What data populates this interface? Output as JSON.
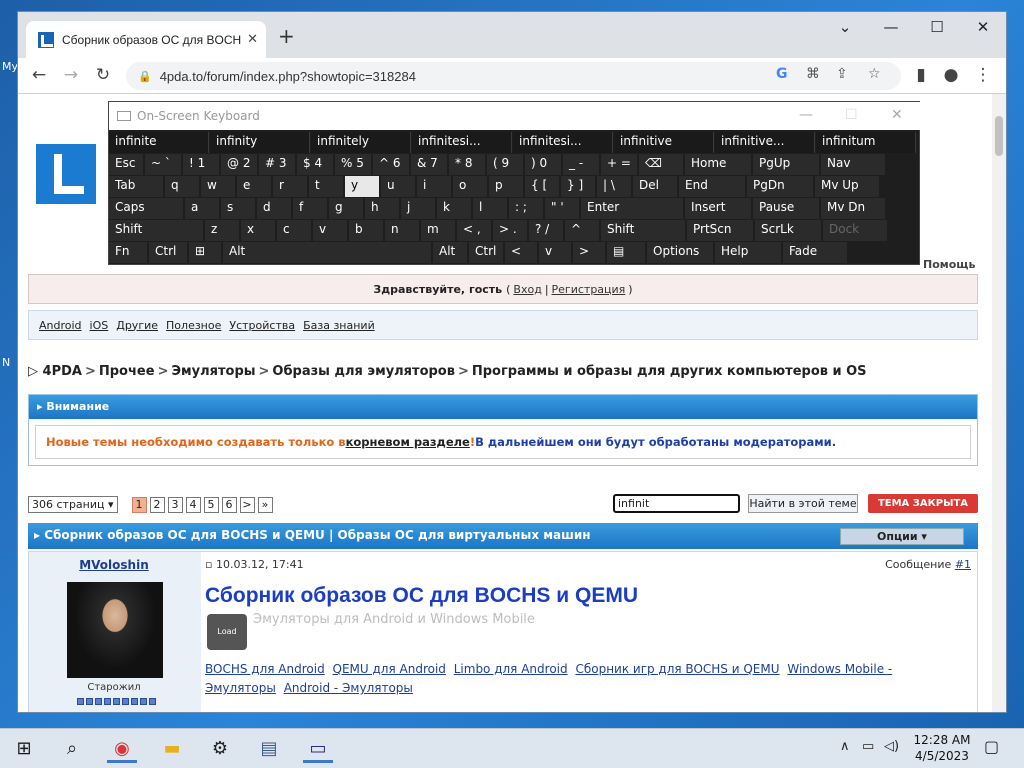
{
  "desktop": {
    "frags": [
      "My",
      "N"
    ]
  },
  "browser": {
    "tab_title": "Сборник образов ОС для BOCHS и QEMU",
    "url": "4pda.to/forum/index.php?showtopic=318284"
  },
  "site": {
    "help": "Помощь",
    "guest": {
      "greeting": "Здравствуйте, гость",
      "paren_open": "(",
      "login": "Вход",
      "divider": "|",
      "register": "Регистрация",
      "paren_close": ")"
    },
    "nav": [
      "Android",
      "iOS",
      "Другие",
      "Полезное",
      "Устройства",
      "База знаний"
    ],
    "breadcrumb": [
      "4PDA",
      "Прочее",
      "Эмуляторы",
      "Образы для эмуляторов",
      "Программы и образы для других компьютеров и OS"
    ],
    "attention": {
      "header": "Внимание",
      "text1": "Новые темы необходимо создавать только в ",
      "link": "корневом разделе",
      "text2": "! ",
      "text3": "В дальнейшем они будут обработаны модераторами."
    },
    "pager": {
      "select": "306 страниц",
      "pages": [
        "1",
        "2",
        "3",
        "4",
        "5",
        "6",
        ">",
        "»"
      ]
    },
    "search": {
      "value": "infinit",
      "button": "Найти в этой теме"
    },
    "closed": "ТЕМА ЗАКРЫТА",
    "topic_bar": "Сборник образов ОС для BOCHS и QEMU | Образы ОС для виртуальных машин",
    "options": "Опции",
    "post": {
      "author": "MVoloshin",
      "rank": "Старожил",
      "date": "10.03.12, 17:41",
      "msg_label": "Сообщение ",
      "msg_no": "#1",
      "title": "Сборник образов ОС для BOCHS и QEMU",
      "subtitle": "Эмуляторы для Android и Windows Mobile",
      "load": "Load",
      "links": [
        "BOCHS для Android",
        "QEMU для Android",
        "Limbo для Android",
        "Сборник игр для BOCHS и QEMU",
        "Windows Mobile - Эмуляторы",
        "Android - Эмуляторы"
      ]
    }
  },
  "osk": {
    "title": "On-Screen Keyboard",
    "predictions": [
      "infinite",
      "infinity",
      "infinitely",
      "infinitesi...",
      "infinitesi...",
      "infinitive",
      "infinitive...",
      "infinitum"
    ],
    "row1": [
      "Esc",
      "~ `",
      "! 1",
      "@ 2",
      "# 3",
      "$ 4",
      "% 5",
      "^ 6",
      "& 7",
      "* 8",
      "( 9",
      ") 0",
      "_ -",
      "+ =",
      "⌫",
      "Home",
      "PgUp",
      "Nav"
    ],
    "row2": [
      "Tab",
      "q",
      "w",
      "e",
      "r",
      "t",
      "y",
      "u",
      "i",
      "o",
      "p",
      "{ [",
      "} ]",
      "| \\",
      "Del",
      "End",
      "PgDn",
      "Mv Up"
    ],
    "row3": [
      "Caps",
      "a",
      "s",
      "d",
      "f",
      "g",
      "h",
      "j",
      "k",
      "l",
      ": ;",
      "\" '",
      "Enter",
      "Insert",
      "Pause",
      "Mv Dn"
    ],
    "row4": [
      "Shift",
      "z",
      "x",
      "c",
      "v",
      "b",
      "n",
      "m",
      "< ,",
      "> .",
      "? /",
      "^",
      "Shift",
      "PrtScn",
      "ScrLk",
      "Dock"
    ],
    "row5": [
      "Fn",
      "Ctrl",
      "⊞",
      "Alt",
      "Alt",
      "Ctrl",
      "<",
      "v",
      ">",
      "▤",
      "Options",
      "Help",
      "Fade"
    ]
  },
  "taskbar": {
    "time": "12:28 AM",
    "date": "4/5/2023"
  }
}
